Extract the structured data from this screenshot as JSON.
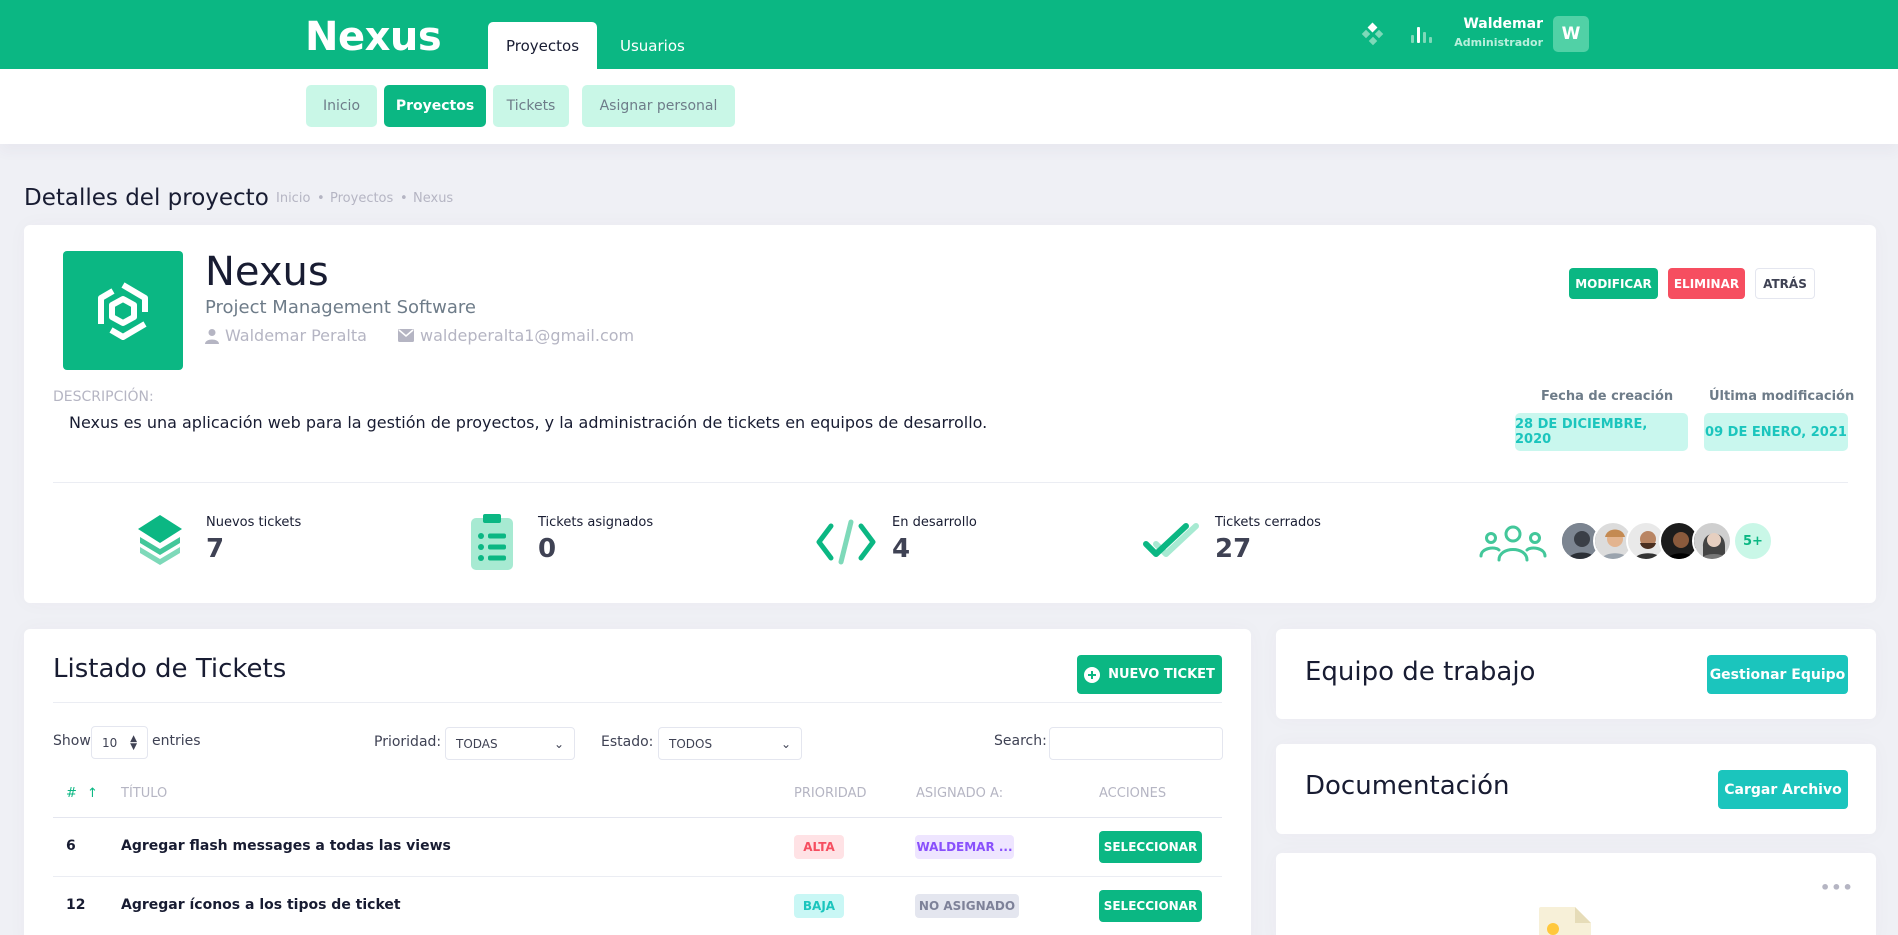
{
  "topbar": {
    "brand": "Nexus",
    "tabs": [
      "Proyectos",
      "Usuarios"
    ],
    "user": {
      "name": "Waldemar",
      "role": "Administrador",
      "initial": "W"
    },
    "icons": [
      "apps-icon",
      "chart-bars-icon"
    ]
  },
  "subnav": {
    "items": [
      "Inicio",
      "Proyectos",
      "Tickets",
      "Asignar personal"
    ],
    "active": "Proyectos"
  },
  "breadcrumb": {
    "title": "Detalles del proyecto",
    "items": [
      "Inicio",
      "Proyectos",
      "Nexus"
    ]
  },
  "project": {
    "name": "Nexus",
    "subtitle": "Project Management Software",
    "owner": "Waldemar Peralta",
    "email": "waldeperalta1@gmail.com",
    "actions": {
      "modify": "MODIFICAR",
      "delete": "ELIMINAR",
      "back": "ATRÁS"
    },
    "description_label": "DESCRIPCIÓN:",
    "description": "Nexus es una aplicación web para la gestión de proyectos, y la administración de tickets en equipos de desarrollo.",
    "created_label": "Fecha de creación",
    "created": "28 DE DICIEMBRE, 2020",
    "modified_label": "Última modificación",
    "modified": "09 DE ENERO, 2021"
  },
  "stats": [
    {
      "label": "Nuevos tickets",
      "value": "7",
      "icon": "layers-icon"
    },
    {
      "label": "Tickets asignados",
      "value": "0",
      "icon": "clipboard-list-icon"
    },
    {
      "label": "En desarrollo",
      "value": "4",
      "icon": "code-icon"
    },
    {
      "label": "Tickets cerrados",
      "value": "27",
      "icon": "double-check-icon"
    }
  ],
  "team": {
    "extra": "5+"
  },
  "tickets": {
    "title": "Listado de Tickets",
    "new_button": "NUEVO TICKET",
    "show_label": "Show",
    "entries_value": "10",
    "entries_label": "entries",
    "priority_label": "Prioridad:",
    "priority_value": "TODAS",
    "status_label": "Estado:",
    "status_value": "TODOS",
    "search_label": "Search:",
    "columns": [
      "#",
      "TÍTULO",
      "PRIORIDAD",
      "ASIGNADO A:",
      "ACCIONES"
    ],
    "rows": [
      {
        "id": "6",
        "title": "Agregar flash messages a todas las views",
        "priority": "ALTA",
        "assigned": "WALDEMAR ...",
        "action": "SELECCIONAR"
      },
      {
        "id": "12",
        "title": "Agregar íconos a los tipos de ticket",
        "priority": "BAJA",
        "assigned": "NO ASIGNADO",
        "action": "SELECCIONAR"
      }
    ]
  },
  "team_card": {
    "title": "Equipo de trabajo",
    "button": "Gestionar Equipo"
  },
  "docs_card": {
    "title": "Documentación",
    "button": "Cargar Archivo"
  },
  "colors": {
    "primary": "#0bb783",
    "danger": "#f64e60",
    "info": "#1bc5bd",
    "purple": "#8950fc"
  }
}
